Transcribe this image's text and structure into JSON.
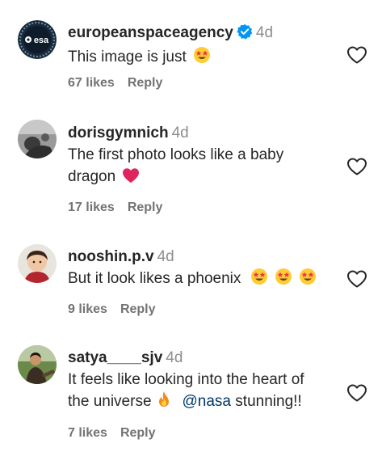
{
  "comments": [
    {
      "username": "europeanspaceagency",
      "verified": true,
      "time": "4d",
      "text_parts": [
        "This image is just"
      ],
      "emoji": [
        "star-struck"
      ],
      "likes": "67 likes",
      "reply": "Reply",
      "avatar_text": "esa"
    },
    {
      "username": "dorisgymnich",
      "verified": false,
      "time": "4d",
      "text_line1": "The first photo looks like a baby",
      "text_line2": "dragon",
      "emoji": [
        "red-heart"
      ],
      "likes": "17 likes",
      "reply": "Reply"
    },
    {
      "username": "nooshin.p.v",
      "verified": false,
      "time": "4d",
      "text": "But it look likes a phoenix",
      "emoji": [
        "star-struck",
        "star-struck",
        "star-struck"
      ],
      "likes": "9 likes",
      "reply": "Reply"
    },
    {
      "username": "satya____sjv",
      "verified": false,
      "time": "4d",
      "text_line1": "It feels like looking into the heart of",
      "text_line2_a": "the universe",
      "mention": "@nasa",
      "text_line2_b": "stunning!!",
      "emoji": [
        "fire"
      ],
      "likes": "7 likes",
      "reply": "Reply"
    }
  ],
  "colors": {
    "text": "#262626",
    "muted": "#737373",
    "timestamp": "#8e8e8e",
    "mention": "#00376b",
    "verified": "#0095f6",
    "heart": "#e0245e",
    "emoji_face": "#ffcc33"
  },
  "icons": [
    "verified-badge-icon",
    "like-heart-icon",
    "star-struck-emoji",
    "red-heart-emoji",
    "fire-emoji"
  ]
}
